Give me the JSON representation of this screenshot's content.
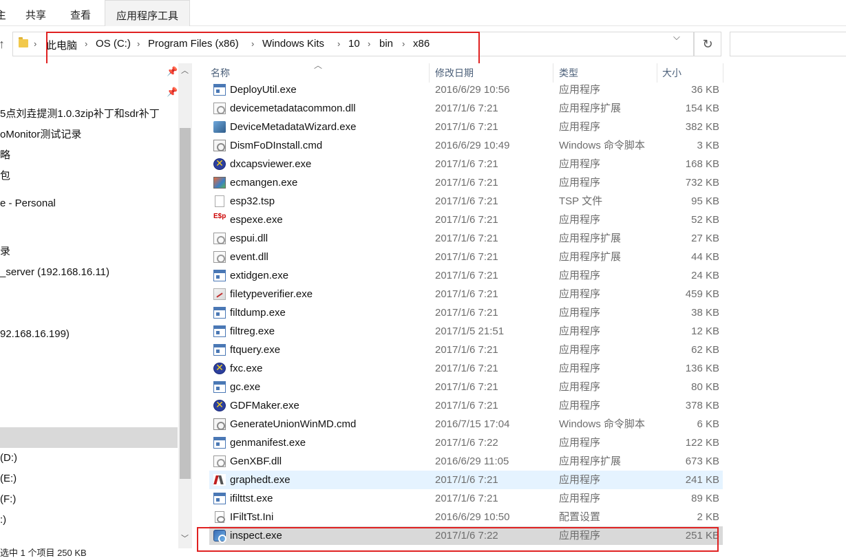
{
  "ribbon": {
    "partial_tab": "主页",
    "tabs": [
      "共享",
      "查看",
      "应用程序工具"
    ]
  },
  "address": {
    "path": [
      "此电脑",
      "OS (C:)",
      "Program Files (x86)",
      "Windows Kits",
      "10",
      "bin",
      "x86"
    ]
  },
  "nav": {
    "items": [
      "5点刘垚提测1.0.3zip补丁和sdr补丁",
      "oMonitor测试记录",
      "略",
      "包",
      "e - Personal",
      "录",
      "_server (192.168.16.11)",
      "92.168.16.199)",
      "(D:)",
      "(E:)",
      "(F:)",
      ":)"
    ]
  },
  "columns": {
    "name": "名称",
    "date": "修改日期",
    "type": "类型",
    "size": "大小"
  },
  "files": [
    {
      "name": "DeployUtil.exe",
      "date": "2016/6/29 10:56",
      "type": "应用程序",
      "size": "36 KB",
      "icon": "exe"
    },
    {
      "name": "devicemetadatacommon.dll",
      "date": "2017/1/6 7:21",
      "type": "应用程序扩展",
      "size": "154 KB",
      "icon": "dll"
    },
    {
      "name": "DeviceMetadataWizard.exe",
      "date": "2017/1/6 7:21",
      "type": "应用程序",
      "size": "382 KB",
      "icon": "wiz"
    },
    {
      "name": "DismFoDInstall.cmd",
      "date": "2016/6/29 10:49",
      "type": "Windows 命令脚本",
      "size": "3 KB",
      "icon": "cmd"
    },
    {
      "name": "dxcapsviewer.exe",
      "date": "2017/1/6 7:21",
      "type": "应用程序",
      "size": "168 KB",
      "icon": "x"
    },
    {
      "name": "ecmangen.exe",
      "date": "2017/1/6 7:21",
      "type": "应用程序",
      "size": "732 KB",
      "icon": "ecm"
    },
    {
      "name": "esp32.tsp",
      "date": "2017/1/6 7:21",
      "type": "TSP 文件",
      "size": "95 KB",
      "icon": "doc"
    },
    {
      "name": "espexe.exe",
      "date": "2017/1/6 7:21",
      "type": "应用程序",
      "size": "52 KB",
      "icon": "esp"
    },
    {
      "name": "espui.dll",
      "date": "2017/1/6 7:21",
      "type": "应用程序扩展",
      "size": "27 KB",
      "icon": "dll"
    },
    {
      "name": "event.dll",
      "date": "2017/1/6 7:21",
      "type": "应用程序扩展",
      "size": "44 KB",
      "icon": "dll"
    },
    {
      "name": "extidgen.exe",
      "date": "2017/1/6 7:21",
      "type": "应用程序",
      "size": "24 KB",
      "icon": "exe"
    },
    {
      "name": "filetypeverifier.exe",
      "date": "2017/1/6 7:21",
      "type": "应用程序",
      "size": "459 KB",
      "icon": "ftv"
    },
    {
      "name": "filtdump.exe",
      "date": "2017/1/6 7:21",
      "type": "应用程序",
      "size": "38 KB",
      "icon": "exe"
    },
    {
      "name": "filtreg.exe",
      "date": "2017/1/5 21:51",
      "type": "应用程序",
      "size": "12 KB",
      "icon": "exe"
    },
    {
      "name": "ftquery.exe",
      "date": "2017/1/6 7:21",
      "type": "应用程序",
      "size": "62 KB",
      "icon": "exe"
    },
    {
      "name": "fxc.exe",
      "date": "2017/1/6 7:21",
      "type": "应用程序",
      "size": "136 KB",
      "icon": "x"
    },
    {
      "name": "gc.exe",
      "date": "2017/1/6 7:21",
      "type": "应用程序",
      "size": "80 KB",
      "icon": "exe"
    },
    {
      "name": "GDFMaker.exe",
      "date": "2017/1/6 7:21",
      "type": "应用程序",
      "size": "378 KB",
      "icon": "x"
    },
    {
      "name": "GenerateUnionWinMD.cmd",
      "date": "2016/7/15 17:04",
      "type": "Windows 命令脚本",
      "size": "6 KB",
      "icon": "cmd"
    },
    {
      "name": "genmanifest.exe",
      "date": "2017/1/6 7:22",
      "type": "应用程序",
      "size": "122 KB",
      "icon": "exe"
    },
    {
      "name": "GenXBF.dll",
      "date": "2016/6/29 11:05",
      "type": "应用程序扩展",
      "size": "673 KB",
      "icon": "dll"
    },
    {
      "name": "graphedt.exe",
      "date": "2017/1/6 7:21",
      "type": "应用程序",
      "size": "241 KB",
      "icon": "graph"
    },
    {
      "name": "ifilttst.exe",
      "date": "2017/1/6 7:21",
      "type": "应用程序",
      "size": "89 KB",
      "icon": "exe"
    },
    {
      "name": "IFiltTst.Ini",
      "date": "2016/6/29 10:50",
      "type": "配置设置",
      "size": "2 KB",
      "icon": "ini"
    },
    {
      "name": "inspect.exe",
      "date": "2017/1/6 7:22",
      "type": "应用程序",
      "size": "251 KB",
      "icon": "inspect"
    }
  ],
  "status": {
    "text": "选中 1 个项目  250 KB"
  }
}
